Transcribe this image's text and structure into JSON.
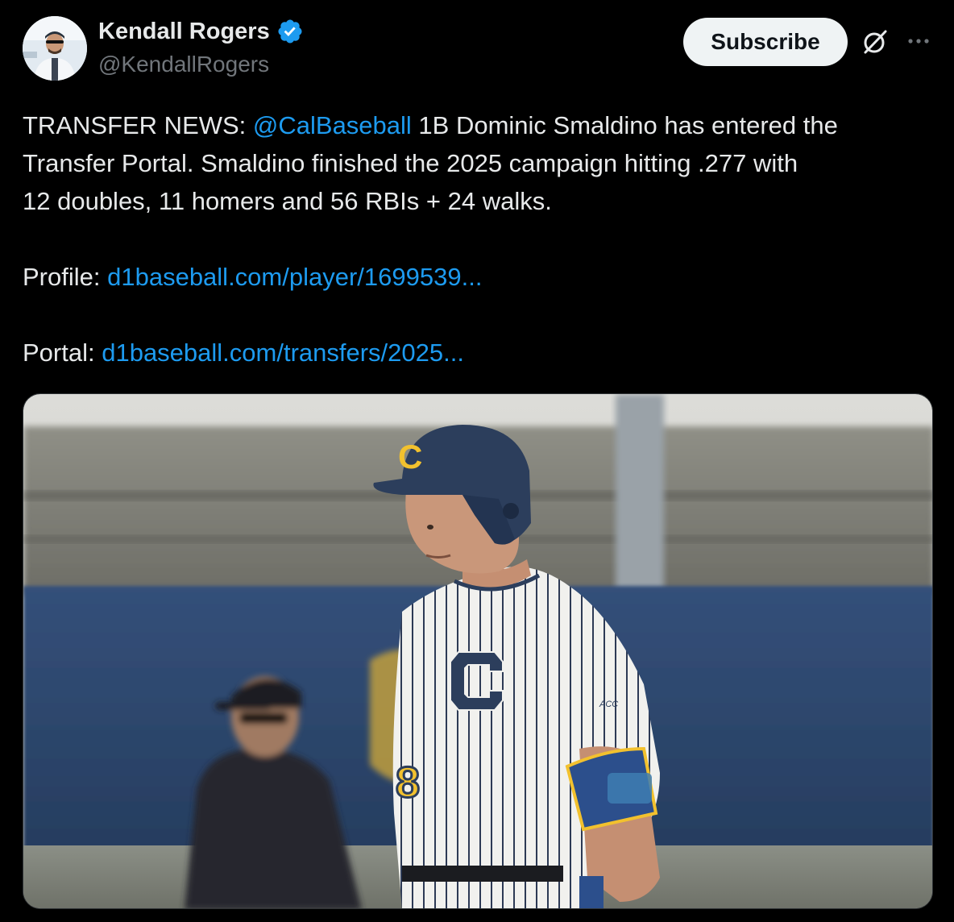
{
  "author": {
    "name": "Kendall Rogers",
    "handle": "@KendallRogers",
    "verified_icon": "verified-badge-icon",
    "verified_color": "#1d9bf0"
  },
  "header": {
    "subscribe_label": "Subscribe",
    "grok_icon": "grok-icon",
    "more_icon": "more-icon"
  },
  "tweet": {
    "line1_prefix": "TRANSFER NEWS: ",
    "mention": "@CalBaseball",
    "line1_suffix": " 1B Dominic Smaldino has entered the",
    "line2": "Transfer Portal. Smaldino finished the 2025 campaign hitting .277 with",
    "line3": "12 doubles, 11 homers and 56 RBIs + 24 walks.",
    "profile_label": "Profile: ",
    "profile_link": "d1baseball.com/player/1699539...",
    "portal_label": "Portal: ",
    "portal_link": "d1baseball.com/transfers/2025...",
    "link_color": "#1d9bf0"
  },
  "media": {
    "helmet_letter": "C",
    "jersey_letter": "C",
    "jersey_number": "8",
    "sleeve_patch": "ACC",
    "brand_navy": "#2c3e5c",
    "brand_gold": "#f2c12e"
  }
}
